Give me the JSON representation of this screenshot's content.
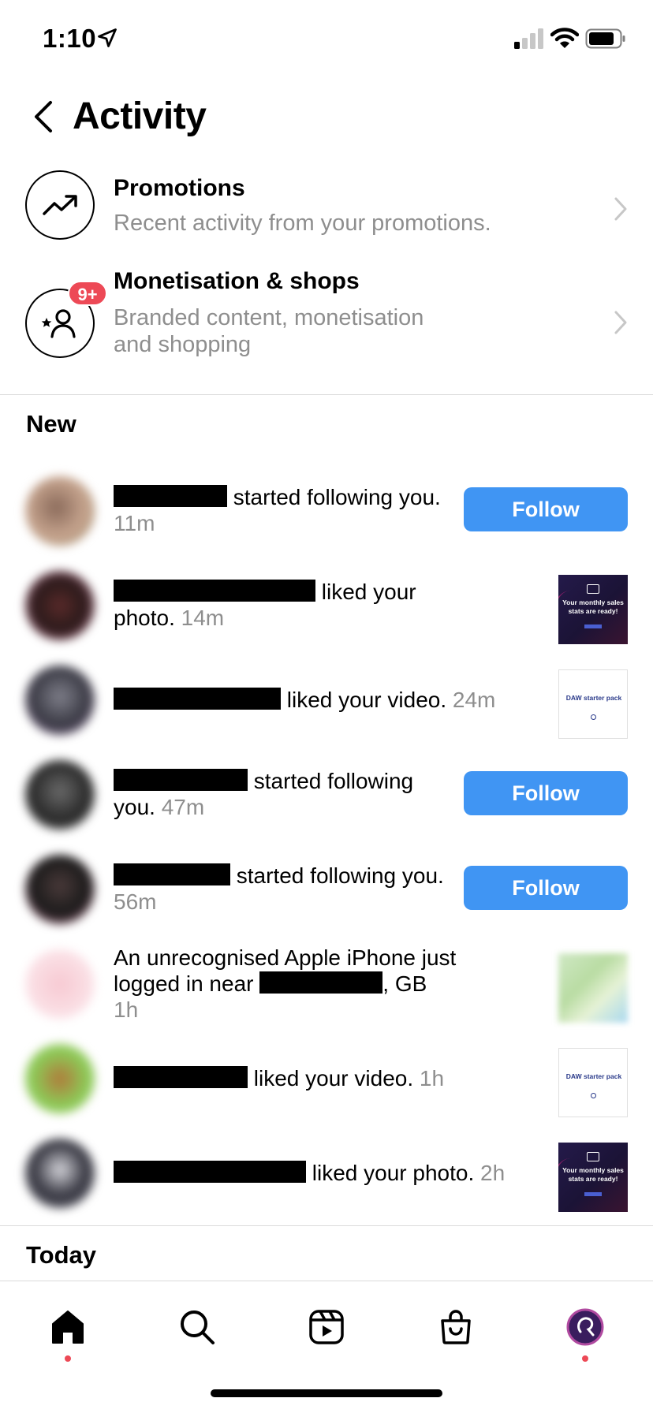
{
  "status_bar": {
    "time": "1:10"
  },
  "header": {
    "title": "Activity"
  },
  "promotions": {
    "title": "Promotions",
    "subtitle": "Recent activity from your promotions."
  },
  "monetisation": {
    "title": "Monetisation & shops",
    "subtitle_line1": "Branded content, monetisation",
    "subtitle_line2": "and shopping",
    "badge": "9+"
  },
  "sections": {
    "new": "New",
    "today": "Today"
  },
  "activities": [
    {
      "action": "started following you.",
      "time": "11m",
      "button": "Follow"
    },
    {
      "action": "liked your photo.",
      "time": "14m",
      "thumb_text": "Your monthly sales stats are ready!"
    },
    {
      "action": "liked your video.",
      "time": "24m",
      "thumb_text": "DAW starter pack"
    },
    {
      "action": "started following you.",
      "time": "47m",
      "button": "Follow"
    },
    {
      "action": "started following you.",
      "time": "56m",
      "button": "Follow"
    },
    {
      "action_part1": "An unrecognised Apple iPhone just logged in near",
      "action_part2": ", GB",
      "time": "1h"
    },
    {
      "action": "liked your video.",
      "time": "1h",
      "thumb_text": "DAW starter pack"
    },
    {
      "action": "liked your photo.",
      "time": "2h",
      "thumb_text": "Your monthly sales stats are ready!"
    }
  ],
  "colors": {
    "accent": "#4095f3",
    "badge": "#ed4956",
    "secondary_text": "#8e8e8e"
  },
  "tab_bar": {
    "icons": [
      "home-icon",
      "search-icon",
      "reels-icon",
      "shop-icon",
      "profile-avatar"
    ]
  }
}
